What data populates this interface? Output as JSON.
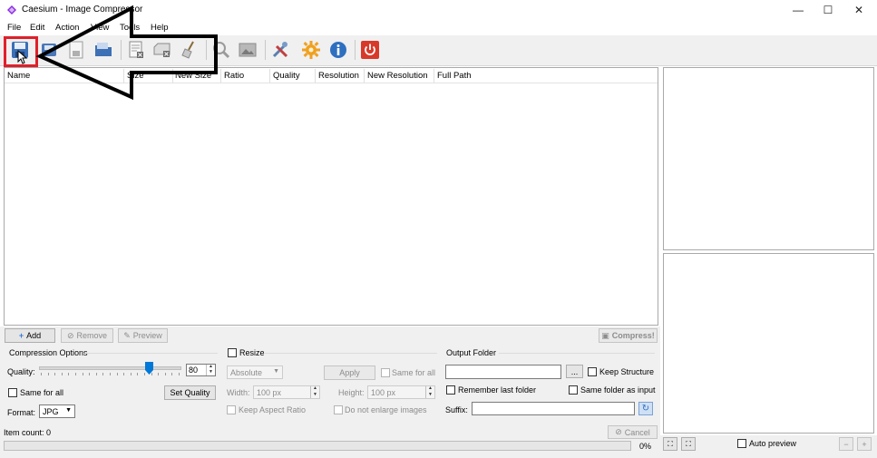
{
  "window": {
    "title": "Caesium - Image Compressor",
    "minimize_glyph": "—",
    "maximize_glyph": "☐",
    "close_glyph": "✕"
  },
  "menu": [
    "File",
    "Edit",
    "Action",
    "View",
    "Tools",
    "Help"
  ],
  "toolbar": {
    "icons": [
      "save-icon",
      "open-icon",
      "save-as-icon",
      "open-folder-icon",
      "remove-icon",
      "clear-icon",
      "broom-icon",
      "search-icon",
      "preview-icon",
      "tools-icon",
      "settings-gear-icon",
      "info-icon",
      "power-icon"
    ],
    "highlight_color": "#e0202a"
  },
  "table": {
    "columns": [
      "Name",
      "Size",
      "New Size",
      "Ratio",
      "Quality",
      "Resolution",
      "New Resolution",
      "Full Path"
    ]
  },
  "actions": {
    "add": "Add",
    "remove": "Remove",
    "preview": "Preview",
    "compress": "Compress!"
  },
  "compression": {
    "title": "Compression Options",
    "quality_label": "Quality:",
    "quality_value": "80",
    "quality_level": 80,
    "same_for_all": "Same for all",
    "set_quality": "Set Quality",
    "format_label": "Format:",
    "format_value": "JPG"
  },
  "resize": {
    "title": "Resize",
    "mode": "Absolute",
    "apply": "Apply",
    "same_for_all": "Same for all",
    "width_label": "Width:",
    "width_value": "100 px",
    "height_label": "Height:",
    "height_value": "100 px",
    "keep_aspect": "Keep Aspect Ratio",
    "no_enlarge": "Do not enlarge images"
  },
  "output": {
    "title": "Output Folder",
    "folder_value": "",
    "browse": "...",
    "keep_structure": "Keep Structure",
    "remember_last": "Remember last folder",
    "same_as_input": "Same folder as input",
    "suffix_label": "Suffix:",
    "suffix_value": ""
  },
  "status": {
    "item_count": "Item count: 0",
    "cancel": "Cancel",
    "progress": "0%",
    "progress_value": 0
  },
  "preview_panel": {
    "auto_preview": "Auto preview"
  }
}
